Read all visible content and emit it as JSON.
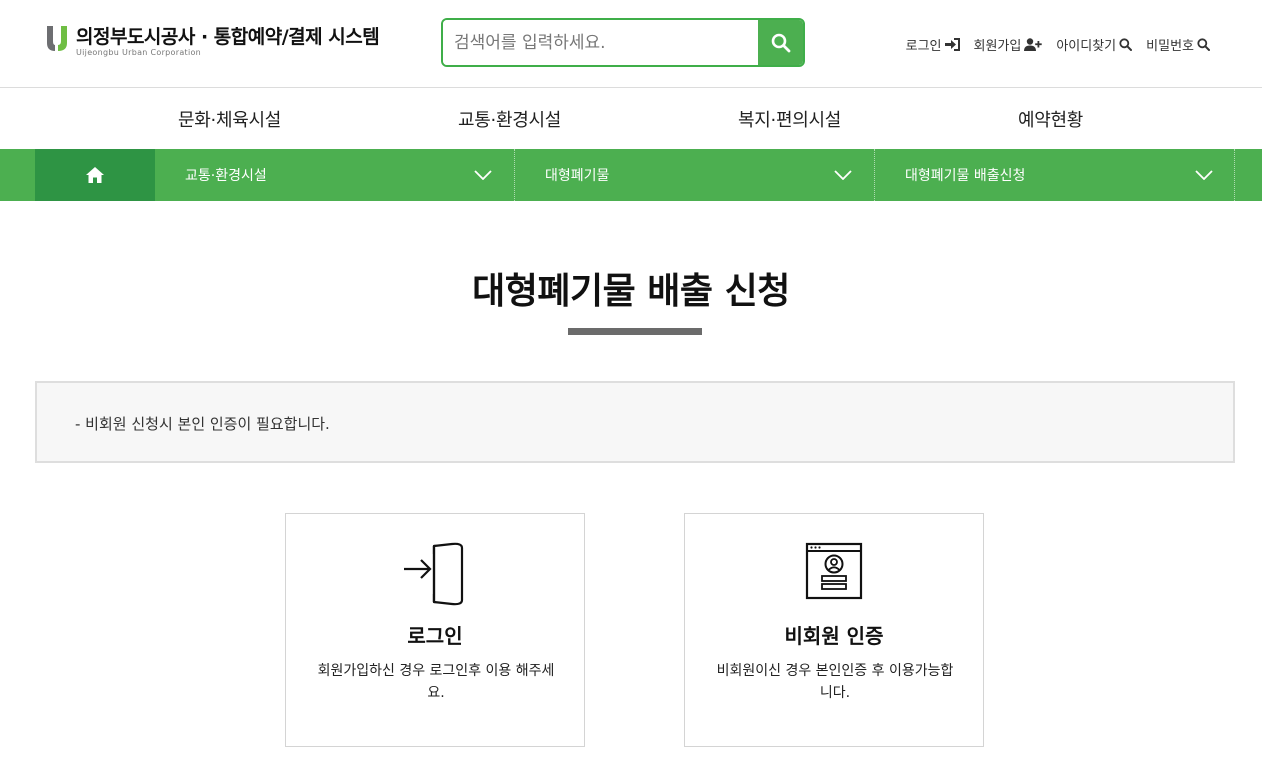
{
  "header": {
    "logo_title": "의정부도시공사 · 통합예약/결제 시스템",
    "logo_sub": "Uijeongbu Urban Corporation",
    "search_placeholder": "검색어를 입력하세요.",
    "util": [
      {
        "label": "로그인",
        "icon": "login-icon"
      },
      {
        "label": "회원가입",
        "icon": "user-plus-icon"
      },
      {
        "label": "아이디찾기",
        "icon": "search-icon"
      },
      {
        "label": "비밀번호",
        "icon": "search-icon"
      }
    ]
  },
  "gnb": [
    {
      "label": "문화·체육시설"
    },
    {
      "label": "교통·환경시설"
    },
    {
      "label": "복지·편의시설"
    },
    {
      "label": "예약현황"
    }
  ],
  "location": {
    "home_icon": "home-icon",
    "crumbs": [
      {
        "label": "교통·환경시설"
      },
      {
        "label": "대형폐기물"
      },
      {
        "label": "대형폐기물 배출신청"
      }
    ]
  },
  "page": {
    "title": "대형폐기물 배출 신청",
    "notice": "- 비회원 신청시 본인 인증이 필요합니다."
  },
  "cards": [
    {
      "title": "로그인",
      "desc": "회원가입하신 경우 로그인후 이용 해주세요.",
      "icon": "login-door-icon"
    },
    {
      "title": "비회원 인증",
      "desc": "비회원이신 경우 본인인증 후 이용가능합니다.",
      "icon": "id-card-icon"
    }
  ],
  "colors": {
    "brand_green": "#4caf50",
    "home_green": "#2e9444",
    "title_bar": "#6b6b6b"
  }
}
